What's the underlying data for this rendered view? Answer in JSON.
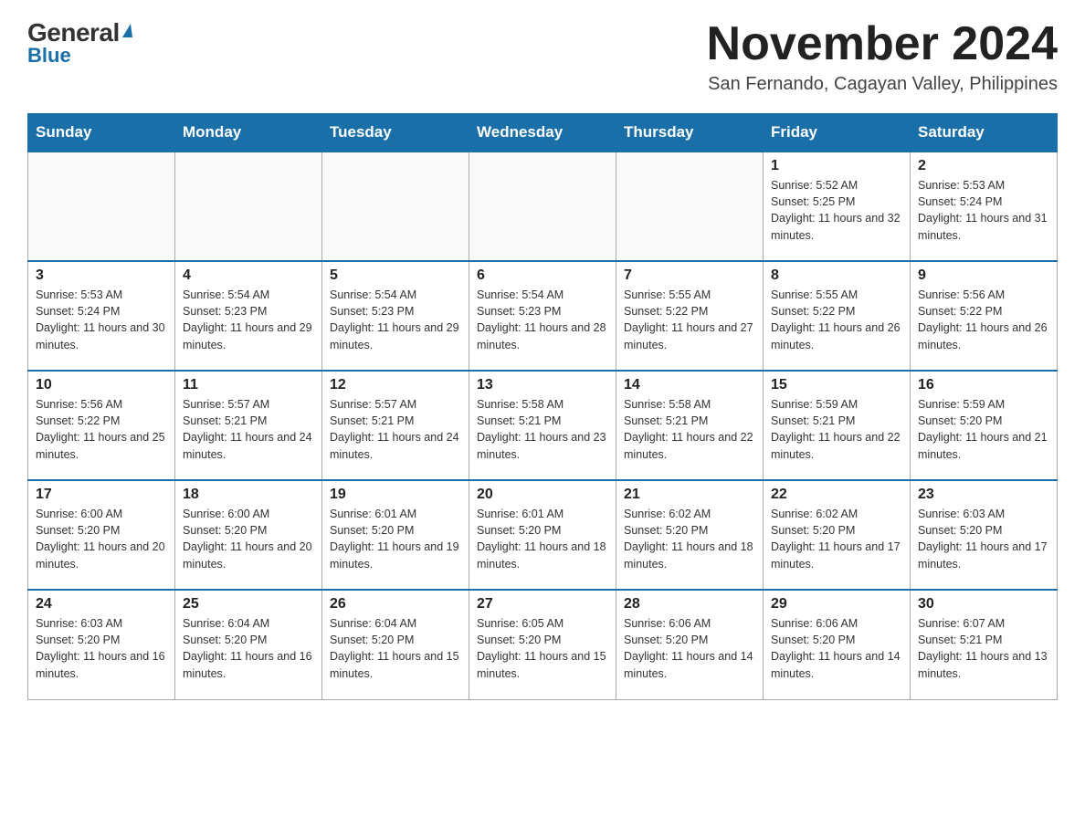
{
  "logo": {
    "general": "General",
    "triangle_char": "▲",
    "blue": "Blue"
  },
  "title": "November 2024",
  "location": "San Fernando, Cagayan Valley, Philippines",
  "days_of_week": [
    "Sunday",
    "Monday",
    "Tuesday",
    "Wednesday",
    "Thursday",
    "Friday",
    "Saturday"
  ],
  "weeks": [
    [
      {
        "day": "",
        "info": ""
      },
      {
        "day": "",
        "info": ""
      },
      {
        "day": "",
        "info": ""
      },
      {
        "day": "",
        "info": ""
      },
      {
        "day": "",
        "info": ""
      },
      {
        "day": "1",
        "info": "Sunrise: 5:52 AM\nSunset: 5:25 PM\nDaylight: 11 hours and 32 minutes."
      },
      {
        "day": "2",
        "info": "Sunrise: 5:53 AM\nSunset: 5:24 PM\nDaylight: 11 hours and 31 minutes."
      }
    ],
    [
      {
        "day": "3",
        "info": "Sunrise: 5:53 AM\nSunset: 5:24 PM\nDaylight: 11 hours and 30 minutes."
      },
      {
        "day": "4",
        "info": "Sunrise: 5:54 AM\nSunset: 5:23 PM\nDaylight: 11 hours and 29 minutes."
      },
      {
        "day": "5",
        "info": "Sunrise: 5:54 AM\nSunset: 5:23 PM\nDaylight: 11 hours and 29 minutes."
      },
      {
        "day": "6",
        "info": "Sunrise: 5:54 AM\nSunset: 5:23 PM\nDaylight: 11 hours and 28 minutes."
      },
      {
        "day": "7",
        "info": "Sunrise: 5:55 AM\nSunset: 5:22 PM\nDaylight: 11 hours and 27 minutes."
      },
      {
        "day": "8",
        "info": "Sunrise: 5:55 AM\nSunset: 5:22 PM\nDaylight: 11 hours and 26 minutes."
      },
      {
        "day": "9",
        "info": "Sunrise: 5:56 AM\nSunset: 5:22 PM\nDaylight: 11 hours and 26 minutes."
      }
    ],
    [
      {
        "day": "10",
        "info": "Sunrise: 5:56 AM\nSunset: 5:22 PM\nDaylight: 11 hours and 25 minutes."
      },
      {
        "day": "11",
        "info": "Sunrise: 5:57 AM\nSunset: 5:21 PM\nDaylight: 11 hours and 24 minutes."
      },
      {
        "day": "12",
        "info": "Sunrise: 5:57 AM\nSunset: 5:21 PM\nDaylight: 11 hours and 24 minutes."
      },
      {
        "day": "13",
        "info": "Sunrise: 5:58 AM\nSunset: 5:21 PM\nDaylight: 11 hours and 23 minutes."
      },
      {
        "day": "14",
        "info": "Sunrise: 5:58 AM\nSunset: 5:21 PM\nDaylight: 11 hours and 22 minutes."
      },
      {
        "day": "15",
        "info": "Sunrise: 5:59 AM\nSunset: 5:21 PM\nDaylight: 11 hours and 22 minutes."
      },
      {
        "day": "16",
        "info": "Sunrise: 5:59 AM\nSunset: 5:20 PM\nDaylight: 11 hours and 21 minutes."
      }
    ],
    [
      {
        "day": "17",
        "info": "Sunrise: 6:00 AM\nSunset: 5:20 PM\nDaylight: 11 hours and 20 minutes."
      },
      {
        "day": "18",
        "info": "Sunrise: 6:00 AM\nSunset: 5:20 PM\nDaylight: 11 hours and 20 minutes."
      },
      {
        "day": "19",
        "info": "Sunrise: 6:01 AM\nSunset: 5:20 PM\nDaylight: 11 hours and 19 minutes."
      },
      {
        "day": "20",
        "info": "Sunrise: 6:01 AM\nSunset: 5:20 PM\nDaylight: 11 hours and 18 minutes."
      },
      {
        "day": "21",
        "info": "Sunrise: 6:02 AM\nSunset: 5:20 PM\nDaylight: 11 hours and 18 minutes."
      },
      {
        "day": "22",
        "info": "Sunrise: 6:02 AM\nSunset: 5:20 PM\nDaylight: 11 hours and 17 minutes."
      },
      {
        "day": "23",
        "info": "Sunrise: 6:03 AM\nSunset: 5:20 PM\nDaylight: 11 hours and 17 minutes."
      }
    ],
    [
      {
        "day": "24",
        "info": "Sunrise: 6:03 AM\nSunset: 5:20 PM\nDaylight: 11 hours and 16 minutes."
      },
      {
        "day": "25",
        "info": "Sunrise: 6:04 AM\nSunset: 5:20 PM\nDaylight: 11 hours and 16 minutes."
      },
      {
        "day": "26",
        "info": "Sunrise: 6:04 AM\nSunset: 5:20 PM\nDaylight: 11 hours and 15 minutes."
      },
      {
        "day": "27",
        "info": "Sunrise: 6:05 AM\nSunset: 5:20 PM\nDaylight: 11 hours and 15 minutes."
      },
      {
        "day": "28",
        "info": "Sunrise: 6:06 AM\nSunset: 5:20 PM\nDaylight: 11 hours and 14 minutes."
      },
      {
        "day": "29",
        "info": "Sunrise: 6:06 AM\nSunset: 5:20 PM\nDaylight: 11 hours and 14 minutes."
      },
      {
        "day": "30",
        "info": "Sunrise: 6:07 AM\nSunset: 5:21 PM\nDaylight: 11 hours and 13 minutes."
      }
    ]
  ]
}
